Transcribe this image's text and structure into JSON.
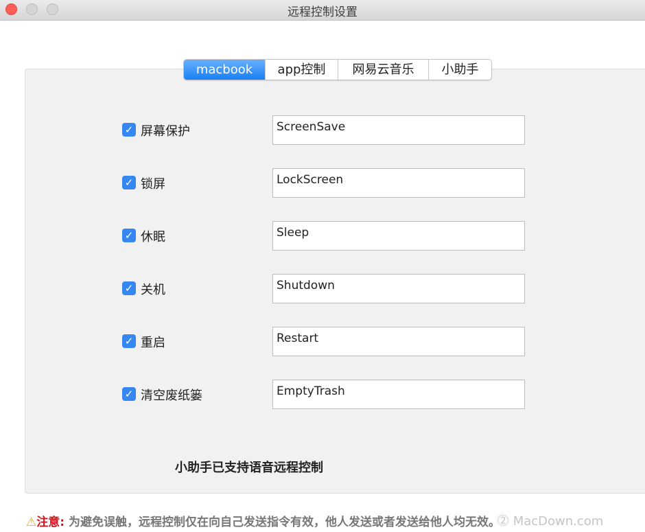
{
  "window": {
    "title": "远程控制设置"
  },
  "tabs": [
    {
      "label": "macbook",
      "active": true
    },
    {
      "label": "app控制",
      "active": false
    },
    {
      "label": "网易云音乐",
      "active": false
    },
    {
      "label": "小助手",
      "active": false
    }
  ],
  "rows": [
    {
      "label": "屏幕保护",
      "checked": true,
      "value": "ScreenSave"
    },
    {
      "label": "锁屏",
      "checked": true,
      "value": "LockScreen"
    },
    {
      "label": "休眠",
      "checked": true,
      "value": "Sleep"
    },
    {
      "label": "关机",
      "checked": true,
      "value": "Shutdown"
    },
    {
      "label": "重启",
      "checked": true,
      "value": "Restart"
    },
    {
      "label": "清空废纸篓",
      "checked": true,
      "value": "EmptyTrash"
    }
  ],
  "note": "小助手已支持语音远程控制",
  "warning": {
    "icon": "warning-triangle-icon",
    "label": "注意:",
    "text": " 为避免误触，远程控制仅在向自己发送指令有效，他人发送或者发送给他人均无效。"
  },
  "watermark": "⓶ MacDown.com",
  "colors": {
    "accent": "#1980f5",
    "checkbox": "#3588f2",
    "warning": "#d8121b"
  }
}
